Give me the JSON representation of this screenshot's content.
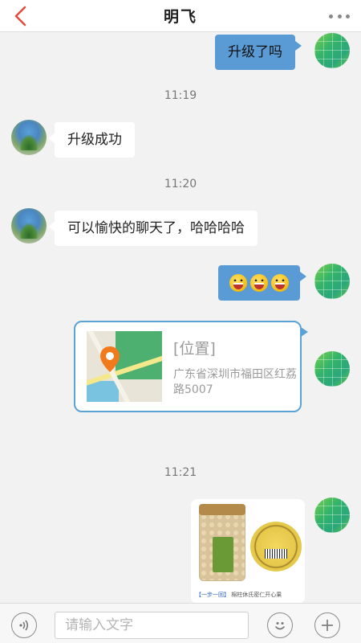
{
  "header": {
    "title": "明飞"
  },
  "messages": {
    "m1_text": "升级了吗",
    "t1": "11:19",
    "m2_text": "升级成功",
    "t2": "11:20",
    "m3_text": "可以愉快的聊天了，哈哈哈哈",
    "t3": "11:21",
    "location_title": "[位置]",
    "location_address": "广东省深圳市福田区红荔路5007",
    "t4": "11:21",
    "image_caption_prefix": "【一步一回】",
    "image_caption_rest": "棉柱休氏密仁开心果"
  },
  "input": {
    "placeholder": "请输入文字"
  },
  "colors": {
    "bubble_right": "#5b9bd5",
    "card_border": "#5aa3d6",
    "back_arrow": "#e04b3a"
  },
  "icons": {
    "back": "chevron-left-icon",
    "more": "more-dots-icon",
    "voice": "voice-icon",
    "emoji": "emoji-icon",
    "plus": "plus-icon",
    "pin": "map-pin-icon"
  }
}
